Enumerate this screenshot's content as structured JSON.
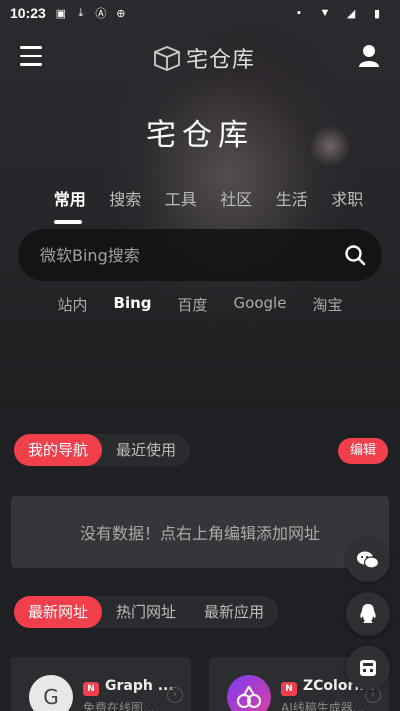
{
  "status_bar": {
    "time": "10:23"
  },
  "header": {
    "logo_text": "宅仓库"
  },
  "hero": {
    "title": "宅仓库"
  },
  "category_tabs": [
    {
      "label": "常用",
      "active": true
    },
    {
      "label": "搜索"
    },
    {
      "label": "工具"
    },
    {
      "label": "社区"
    },
    {
      "label": "生活"
    },
    {
      "label": "求职"
    }
  ],
  "search": {
    "placeholder": "微软Bing搜索"
  },
  "engines": [
    {
      "label": "站内"
    },
    {
      "label": "Bing",
      "active": true
    },
    {
      "label": "百度"
    },
    {
      "label": "Google"
    },
    {
      "label": "淘宝"
    }
  ],
  "nav_section": {
    "tabs": [
      "我的导航",
      "最近使用"
    ],
    "edit_label": "编辑",
    "empty_text": "没有数据！点右上角编辑添加网址"
  },
  "sites_section": {
    "tabs": [
      "最新网址",
      "热门网址",
      "最新应用"
    ]
  },
  "cards": [
    {
      "badge": "N",
      "name": "Graph ...",
      "desc": "免费在线图...",
      "avatar_letter": "G"
    },
    {
      "badge": "N",
      "name": "ZColori...",
      "desc": "AI线稿生成器..."
    }
  ],
  "colors": {
    "accent": "#f1404b",
    "background": "#1f2023"
  }
}
